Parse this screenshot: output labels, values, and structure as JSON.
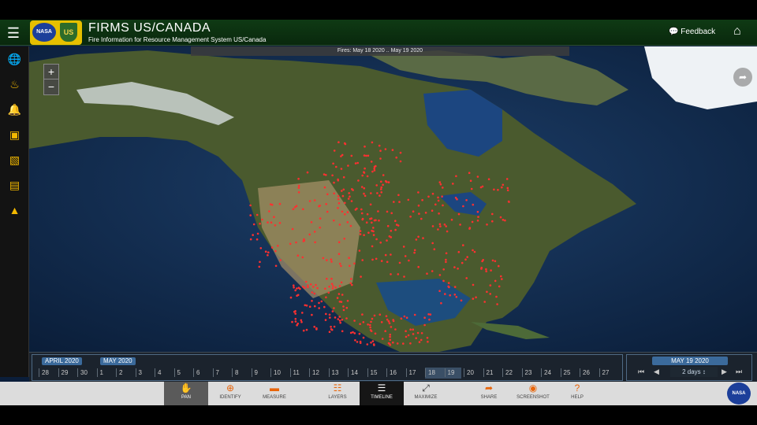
{
  "header": {
    "title": "FIRMS US/CANADA",
    "subtitle": "Fire Information for Resource Management System US/Canada",
    "feedback_label": "Feedback",
    "logo_nasa": "NASA",
    "logo_fs": "US"
  },
  "map": {
    "fires_label": "Fires: May 18 2020 .. May 19 2020"
  },
  "timeline": {
    "months": [
      "APRIL 2020",
      "MAY 2020"
    ],
    "april_days": [
      "28",
      "29",
      "30"
    ],
    "may_days": [
      "1",
      "2",
      "3",
      "4",
      "5",
      "6",
      "7",
      "8",
      "9",
      "10",
      "11",
      "12",
      "13",
      "14",
      "15",
      "16",
      "17",
      "18",
      "19",
      "20",
      "21",
      "22",
      "23",
      "24",
      "25",
      "26",
      "27"
    ],
    "selected_date": "MAY 19 2020",
    "range_value": "2 days"
  },
  "toolbar": {
    "tools": [
      {
        "label": "PAN",
        "icon": "hand-icon"
      },
      {
        "label": "IDENTIFY",
        "icon": "crosshair-icon"
      },
      {
        "label": "MEASURE",
        "icon": "ruler-icon"
      },
      {
        "label": "LAYERS",
        "icon": "layers-icon"
      },
      {
        "label": "TIMELINE",
        "icon": "sliders-icon"
      },
      {
        "label": "MAXIMIZE",
        "icon": "expand-icon"
      },
      {
        "label": "SHARE",
        "icon": "share-icon"
      },
      {
        "label": "SCREENSHOT",
        "icon": "camera-icon"
      },
      {
        "label": "HELP",
        "icon": "question-icon"
      }
    ],
    "logo_nasa": "NASA"
  },
  "colors": {
    "header_bg": "#0f3a14",
    "accent": "#f2b800",
    "fire": "#ff3030",
    "timeline_tag": "#3b6a9b"
  }
}
